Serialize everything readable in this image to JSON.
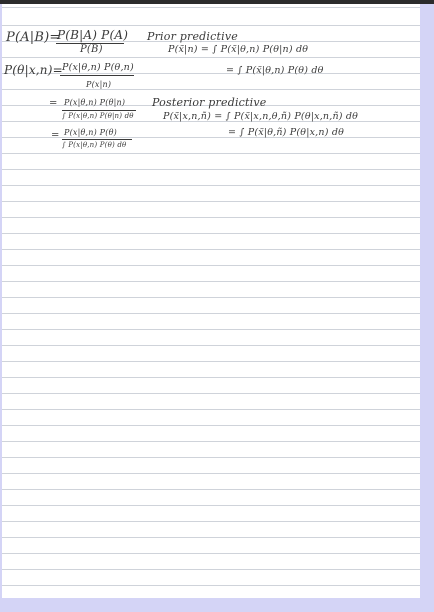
{
  "notes": {
    "bayes_lhs": "P(A|B)=",
    "bayes_num": "P(B|A) P(A)",
    "bayes_den": "P(B)",
    "posterior_lhs": "P(θ|x,n)=",
    "posterior_num": "P(x|θ,n) P(θ,n)",
    "posterior_den": "P(x|n)",
    "eq2": "=",
    "posterior2_num": "P(x|θ,n) P(θ|n)",
    "posterior2_den": "∫ P(x|θ,n) P(θ|n) dθ",
    "eq3": "=",
    "posterior3_num": "P(x|θ,n) P(θ)",
    "posterior3_den": "∫ P(x|θ,n) P(θ) dθ",
    "prior_pred_title": "Prior predictive",
    "prior_pred_line1": "P(x̃|n) = ∫ P(x̃|θ,n) P(θ|n) dθ",
    "prior_pred_line2": "= ∫ P(x̃|θ,n) P(θ) dθ",
    "post_pred_title": "Posterior predictive",
    "post_pred_line1": "P(x̃|x,n,ñ) = ∫ P(x̃|x,n,θ,ñ) P(θ|x,n,ñ) dθ",
    "post_pred_line2": "= ∫ P(x̃|θ,ñ) P(θ|x,n) dθ"
  },
  "colors": {
    "ink": "#3a3a3a",
    "rule_lines": "#cfd3da",
    "background": "#d4d4f6",
    "top_bar": "#2c2c2c"
  }
}
